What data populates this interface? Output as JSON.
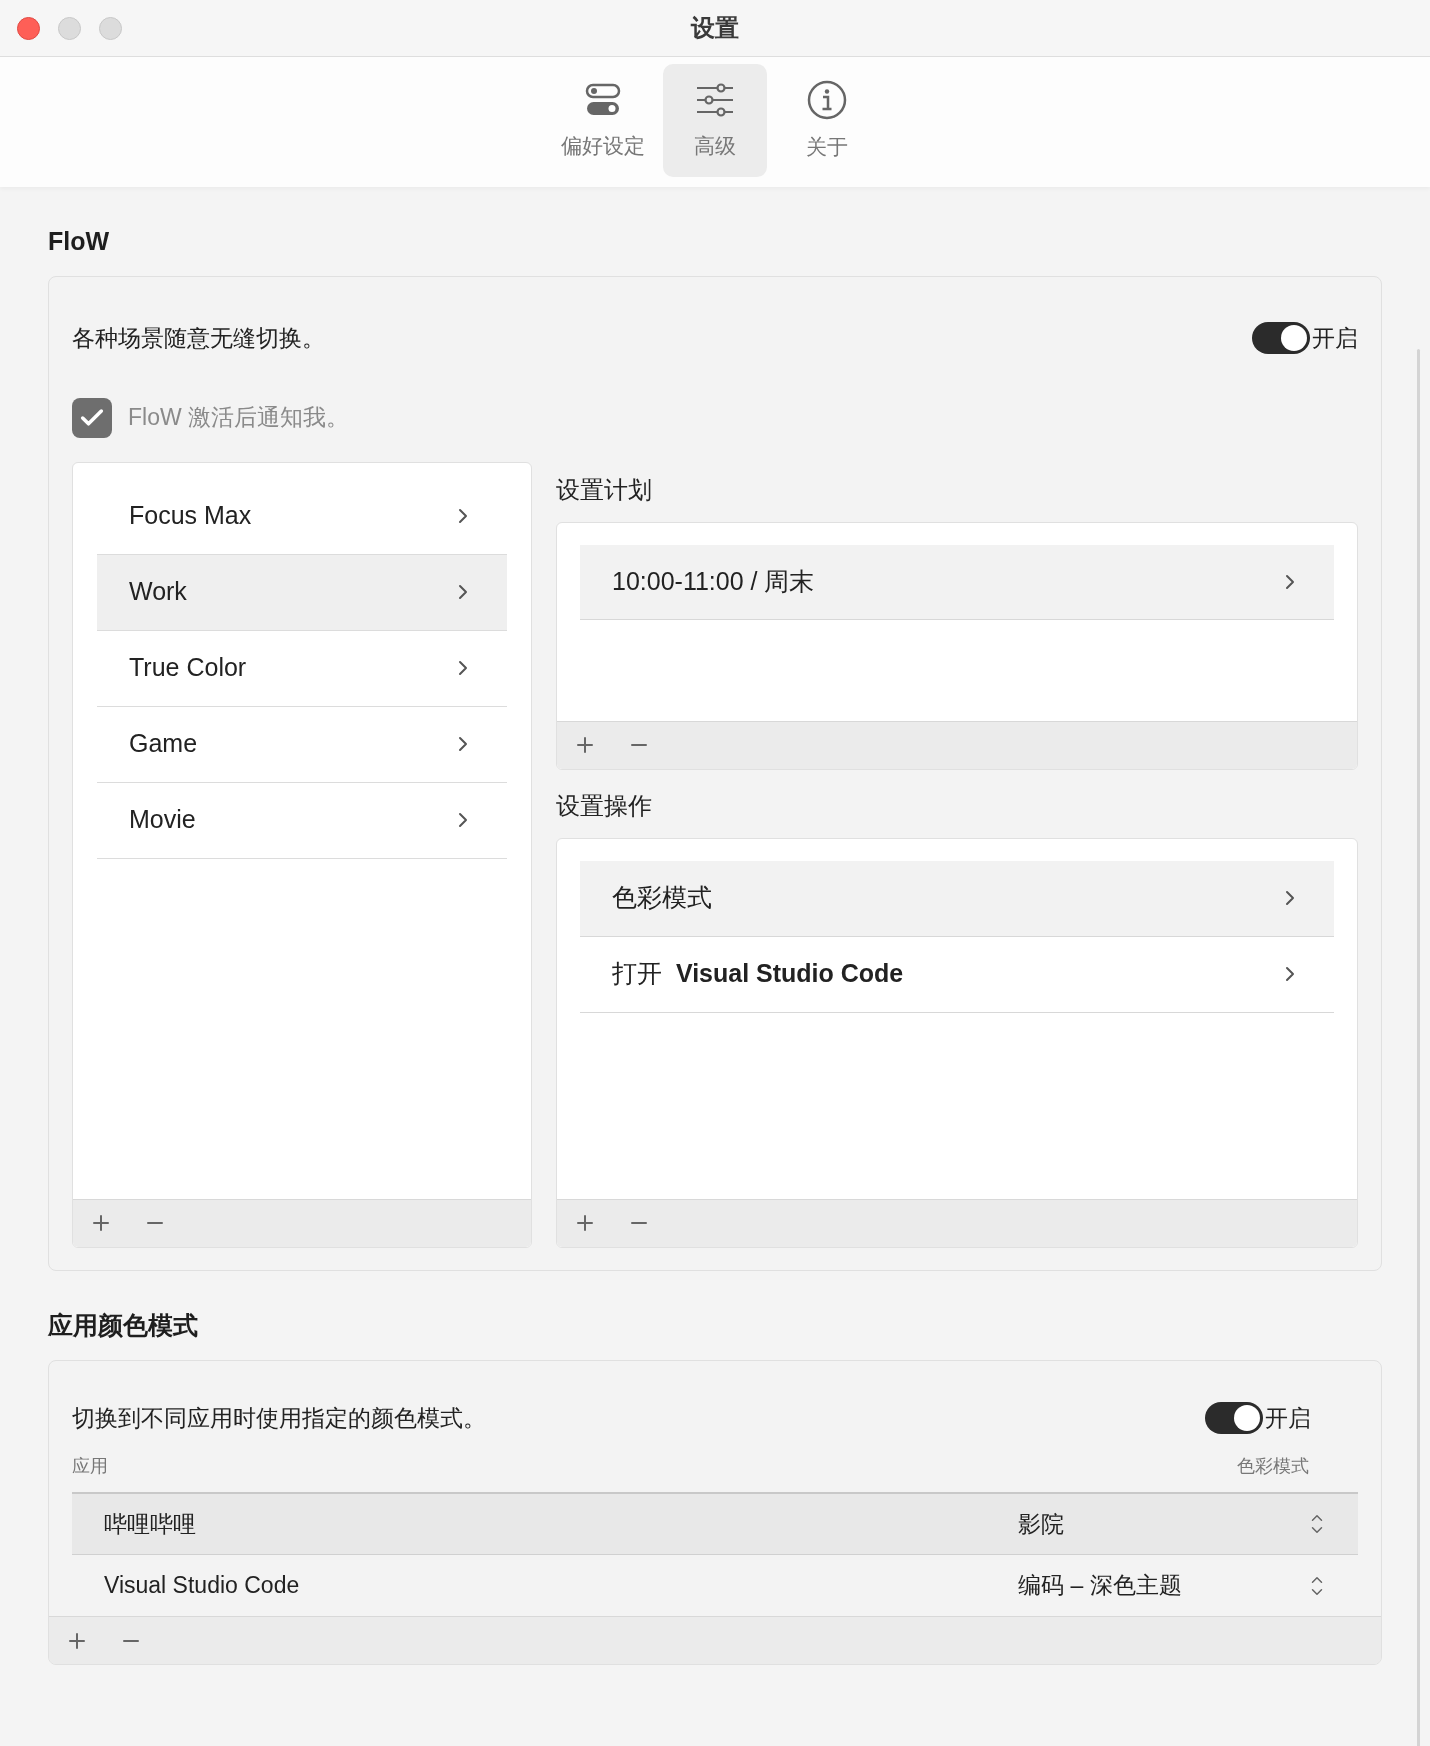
{
  "window": {
    "title": "设置"
  },
  "tabs": [
    {
      "label": "偏好设定",
      "kind": "toggles",
      "selected": false
    },
    {
      "label": "高级",
      "kind": "sliders",
      "selected": true
    },
    {
      "label": "关于",
      "kind": "info",
      "selected": false
    }
  ],
  "flow": {
    "heading": "FloW",
    "description": "各种场景随意无缝切换。",
    "toggle": {
      "on": true,
      "label": "开启"
    },
    "notify": {
      "checked": true,
      "label": "FloW 激活后通知我。"
    },
    "scenes": [
      {
        "label": "Focus Max",
        "selected": false
      },
      {
        "label": "Work",
        "selected": true
      },
      {
        "label": "True Color",
        "selected": false
      },
      {
        "label": "Game",
        "selected": false
      },
      {
        "label": "Movie",
        "selected": false
      }
    ],
    "schedule": {
      "heading": "设置计划",
      "items": [
        {
          "time": "10:00-11:00",
          "days": "/ 周末",
          "selected": true
        }
      ]
    },
    "actions": {
      "heading": "设置操作",
      "items": [
        {
          "label": "色彩模式",
          "selected": true
        },
        {
          "label": "打开  **Visual Studio Code**",
          "selected": false
        }
      ]
    }
  },
  "color_mode": {
    "heading": "应用颜色模式",
    "description": "切换到不同应用时使用指定的颜色模式。",
    "toggle": {
      "on": true,
      "label": "开启"
    },
    "table": {
      "columns": [
        "应用",
        "色彩模式"
      ],
      "rows": [
        {
          "app": "哔哩哔哩",
          "mode": "影院",
          "selected": true
        },
        {
          "app": "Visual Studio Code",
          "mode": "编码 – 深色主题",
          "selected": false
        }
      ]
    }
  }
}
